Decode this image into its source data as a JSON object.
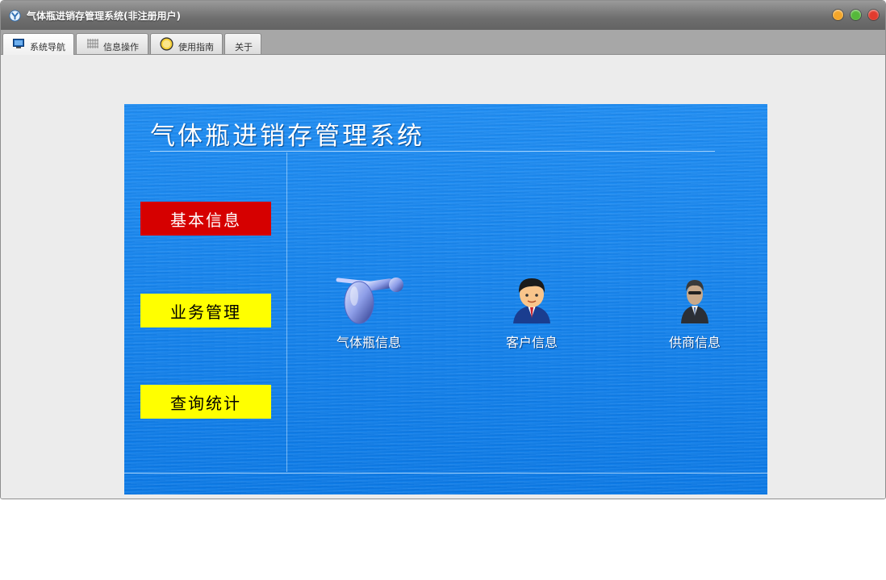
{
  "window": {
    "title": "气体瓶进销存管理系统(非注册用户)",
    "controls": [
      {
        "name": "minimize-button",
        "color": "#f4a62a"
      },
      {
        "name": "maximize-button",
        "color": "#55b83a"
      },
      {
        "name": "close-button",
        "color": "#e23b2e"
      }
    ]
  },
  "tabs": [
    {
      "label": "系统导航",
      "icon": "monitor-icon",
      "active": true
    },
    {
      "label": "信息操作",
      "icon": "grid-icon",
      "active": false
    },
    {
      "label": "使用指南",
      "icon": "help-icon",
      "active": false
    },
    {
      "label": "关于",
      "icon": "",
      "active": false
    }
  ],
  "panel": {
    "title": "气体瓶进销存管理系统",
    "background_color": "#1883f0",
    "menu": [
      {
        "label": "基本信息",
        "bg": "#d60000",
        "color": "#ffffff"
      },
      {
        "label": "业务管理",
        "bg": "#ffff00",
        "color": "#000000"
      },
      {
        "label": "查询统计",
        "bg": "#ffff00",
        "color": "#000000"
      }
    ],
    "items": [
      {
        "label": "气体瓶信息",
        "icon": "gas-cylinder-icon"
      },
      {
        "label": "客户信息",
        "icon": "customer-icon"
      },
      {
        "label": "供商信息",
        "icon": "supplier-icon"
      }
    ]
  }
}
